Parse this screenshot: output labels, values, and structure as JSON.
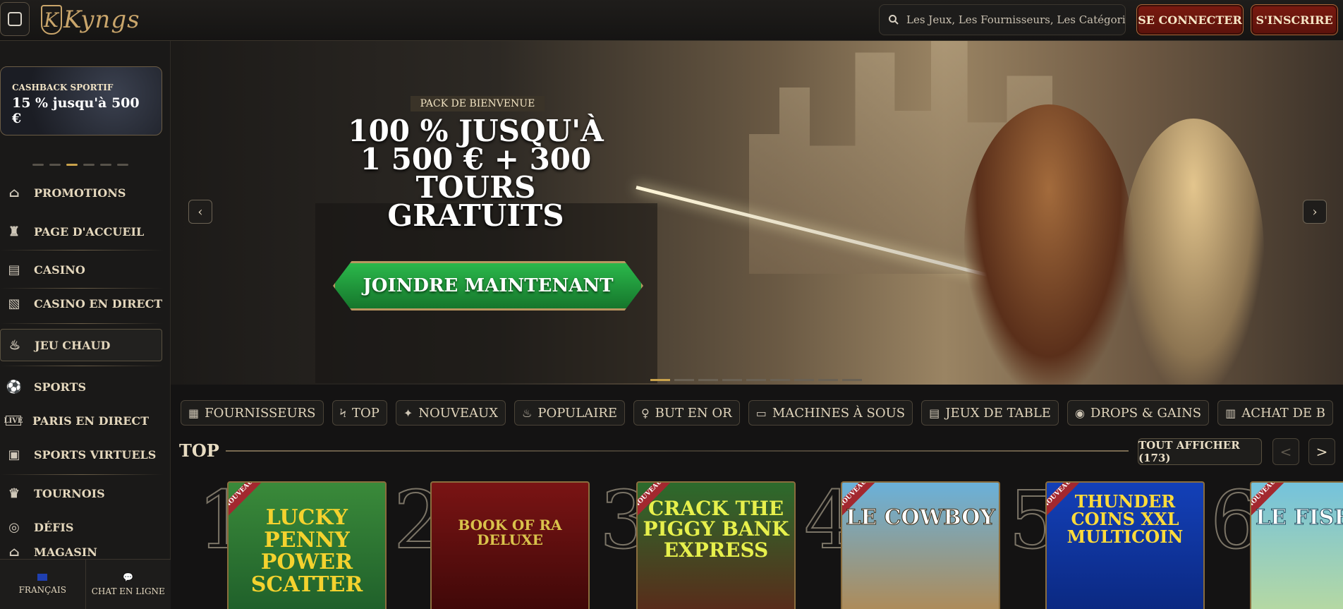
{
  "header": {
    "logo_text": "Kyngs",
    "search_placeholder": "Les Jeux, Les Fournisseurs, Les Catégories",
    "login_label": "SE CONNECTER",
    "signup_label": "S'INSCRIRE"
  },
  "sidebar": {
    "promo": {
      "small": "CASHBACK SPORTIF",
      "big": "15 % jusqu'à 500 €"
    },
    "items": [
      {
        "label": "PROMOTIONS",
        "icon": "gift-icon"
      },
      {
        "label": "PAGE D'ACCUEIL",
        "icon": "castle-icon"
      },
      {
        "label": "CASINO",
        "icon": "casino-icon"
      },
      {
        "label": "CASINO EN DIRECT",
        "icon": "cards-icon"
      },
      {
        "label": "JEU CHAUD",
        "icon": "flame-icon"
      },
      {
        "label": "SPORTS",
        "icon": "soccer-ball-icon"
      },
      {
        "label": "PARIS EN DIRECT",
        "icon": "live-icon"
      },
      {
        "label": "SPORTS VIRTUELS",
        "icon": "virtual-sports-icon"
      },
      {
        "label": "TOURNOIS",
        "icon": "trophy-icon"
      },
      {
        "label": "DÉFIS",
        "icon": "challenge-icon"
      },
      {
        "label": "MAGASIN",
        "icon": "shop-icon"
      }
    ],
    "footer": {
      "language": "FRANÇAIS",
      "chat": "CHAT EN LIGNE"
    }
  },
  "hero": {
    "badge": "PACK DE BIENVENUE",
    "headline": "100 % JUSQU'À 1 500 € + 300 TOURS GRATUITS",
    "cta": "JOINDRE MAINTENANT",
    "prev": "‹",
    "next": "›"
  },
  "categories": [
    {
      "label": "FOURNISSEURS",
      "icon": "book-icon"
    },
    {
      "label": "TOP",
      "icon": "bolt-icon"
    },
    {
      "label": "NOUVEAUX",
      "icon": "new-icon"
    },
    {
      "label": "POPULAIRE",
      "icon": "flame-icon"
    },
    {
      "label": "BUT EN OR",
      "icon": "golden-goal-icon"
    },
    {
      "label": "MACHINES À SOUS",
      "icon": "slot-icon"
    },
    {
      "label": "JEUX DE TABLE",
      "icon": "table-games-icon"
    },
    {
      "label": "DROPS & GAINS",
      "icon": "drops-icon"
    },
    {
      "label": "ACHAT DE B",
      "icon": "gift-box-icon"
    }
  ],
  "top_section": {
    "title": "TOP",
    "view_all": "TOUT AFFICHER (173)",
    "prev": "<",
    "next": ">",
    "games": [
      {
        "rank": "1",
        "title": "LUCKY PENNY POWER SCATTER",
        "badge": "NOUVEAU",
        "bg": "#3a8a3a",
        "fg": "#f4d22e"
      },
      {
        "rank": "2",
        "title": "BOOK OF RA DELUXE",
        "badge": "",
        "bg": "#7a1414",
        "fg": "#d9c24b"
      },
      {
        "rank": "3",
        "title": "CRACK THE PIGGY BANK EXPRESS",
        "badge": "NOUVEAU",
        "bg": "#2c6b2c",
        "fg": "#e7f04c"
      },
      {
        "rank": "4",
        "title": "LE COWBOY",
        "badge": "NOUVEAU",
        "bg": "#6ab1da",
        "fg": "#ffffff"
      },
      {
        "rank": "5",
        "title": "THUNDER COINS XXL MULTICOIN",
        "badge": "NOUVEAU",
        "bg": "#1340b8",
        "fg": "#ffdb3a"
      },
      {
        "rank": "6",
        "title": "LE FISHE",
        "badge": "NOUVEAU",
        "bg": "#74c2dc",
        "fg": "#ffffff"
      }
    ]
  }
}
